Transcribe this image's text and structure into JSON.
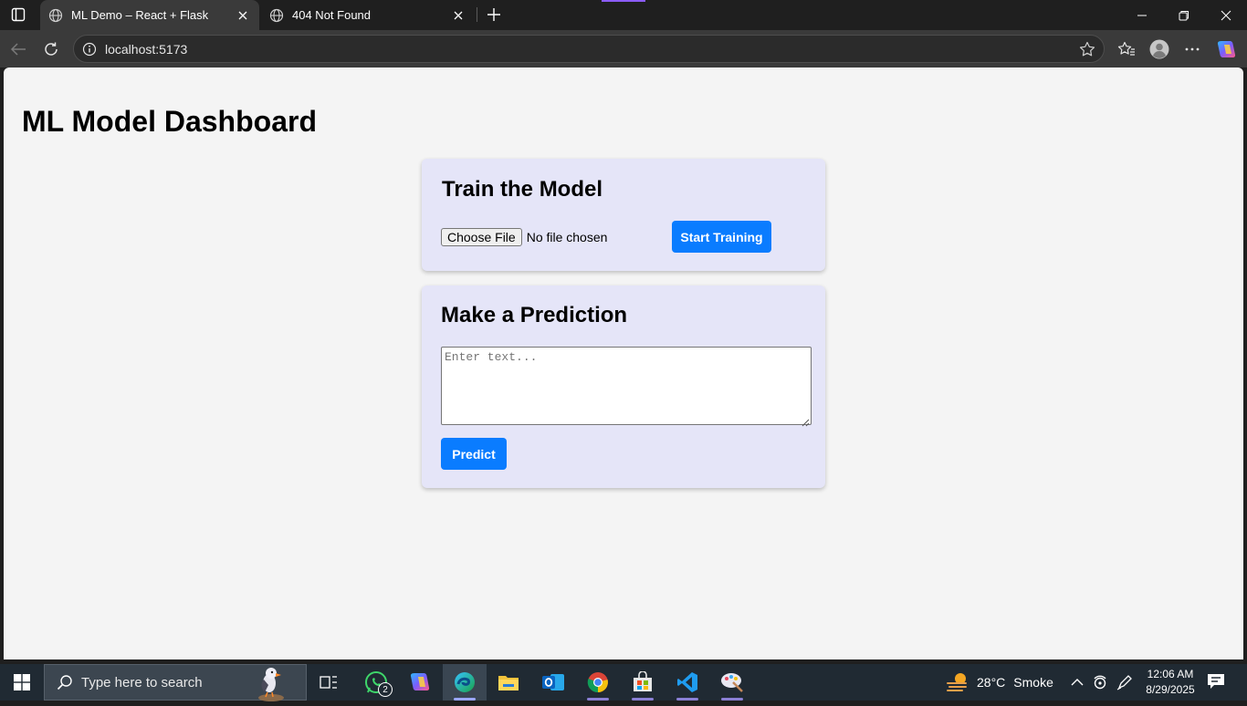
{
  "browser": {
    "tabs": [
      {
        "title": "ML Demo – React + Flask",
        "active": true
      },
      {
        "title": "404 Not Found",
        "active": false
      }
    ],
    "address": "localhost:5173"
  },
  "page": {
    "title": "ML Model Dashboard",
    "train": {
      "heading": "Train the Model",
      "choose_file_label": "Choose File",
      "file_status": "No file chosen",
      "start_button": "Start Training"
    },
    "predict": {
      "heading": "Make a Prediction",
      "input_placeholder": "Enter text...",
      "predict_button": "Predict"
    }
  },
  "taskbar": {
    "search_placeholder": "Type here to search",
    "whatsapp_badge": "2",
    "weather": {
      "temp": "28°C",
      "condition": "Smoke"
    },
    "clock": {
      "time": "12:06 AM",
      "date": "8/29/2025"
    }
  },
  "colors": {
    "accent_button": "#0a7cff",
    "card_background": "#e5e5f8",
    "page_background": "#f4f4f4"
  }
}
